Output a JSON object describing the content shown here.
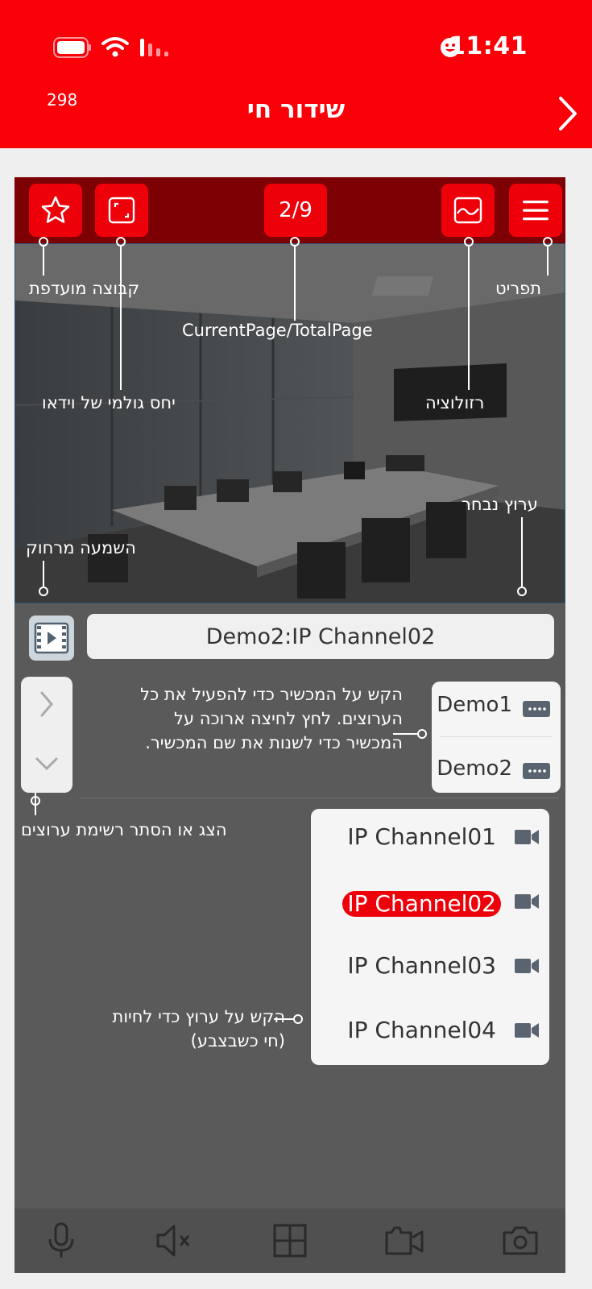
{
  "status_bar": {
    "time": "11:41",
    "notification_count": "298"
  },
  "header": {
    "title": "שידור חי"
  },
  "toolbar": {
    "page_indicator": "2/9"
  },
  "annotations": {
    "favorite_group": "קבוצה מועדפת",
    "favorite_group_b": "קבוצה",
    "favorite_group_a": "מועדפת",
    "menu": "תפריט",
    "current_page": "CurrentPage/TotalPage",
    "aspect_ratio": "יחס גולמי של וידאו",
    "resolution": "רזולוציה",
    "selected_channel": "ערוץ נבחר",
    "remote_listen": "השמעה מרחוק",
    "device_tip_1": "הקש על המכשיר כדי להפעיל את כל",
    "device_tip_2": "הערוצים. לחץ לחיצה ארוכה על",
    "device_tip_3": "המכשיר כדי לשנות את שם המכשיר.",
    "toggle_list": "הצג או הסתר רשימת ערוצים",
    "channel_tip_1": "הקש על ערוץ כדי לחיות",
    "channel_tip_2": "(חי כשבצבע)"
  },
  "selected_channel_name": "Demo2:IP Channel02",
  "devices": [
    {
      "label": "Demo1",
      "icon": "dvr-icon"
    },
    {
      "label": "Demo2",
      "icon": "dvr-icon"
    }
  ],
  "channels": [
    {
      "label": "IP Channel01",
      "icon": "camera-icon",
      "active": false
    },
    {
      "label": "IP Channel02",
      "icon": "camera-icon",
      "active": true
    },
    {
      "label": "IP Channel03",
      "icon": "camera-icon",
      "active": false
    },
    {
      "label": "IP Channel04",
      "icon": "camera-icon",
      "active": false
    }
  ],
  "bottom_bar": [
    "microphone-icon",
    "mute-icon",
    "grid-icon",
    "record-icon",
    "capture-icon"
  ],
  "colors": {
    "brand_red": "#fa0008",
    "toolbar_dark": "#7d0004",
    "panel_gray": "#5a5a5a"
  }
}
